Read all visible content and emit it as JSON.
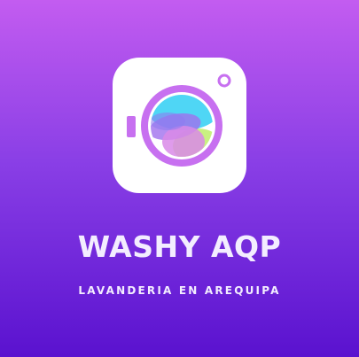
{
  "brand": {
    "name": "WASHY AQP",
    "tagline": "LAVANDERIA EN AREQUIPA"
  },
  "logo": {
    "icon": "washing-machine-icon",
    "colors": {
      "card": "#ffffff",
      "ring": "#c770f0",
      "water_blue": "#4fd6f5",
      "water_green": "#c6f07a",
      "water_purple": "#a070ee",
      "water_pink": "#d98ae8"
    }
  },
  "colors": {
    "background_top": "#c35cf0",
    "background_bottom": "#5a12cf",
    "text": "#f3edff"
  }
}
